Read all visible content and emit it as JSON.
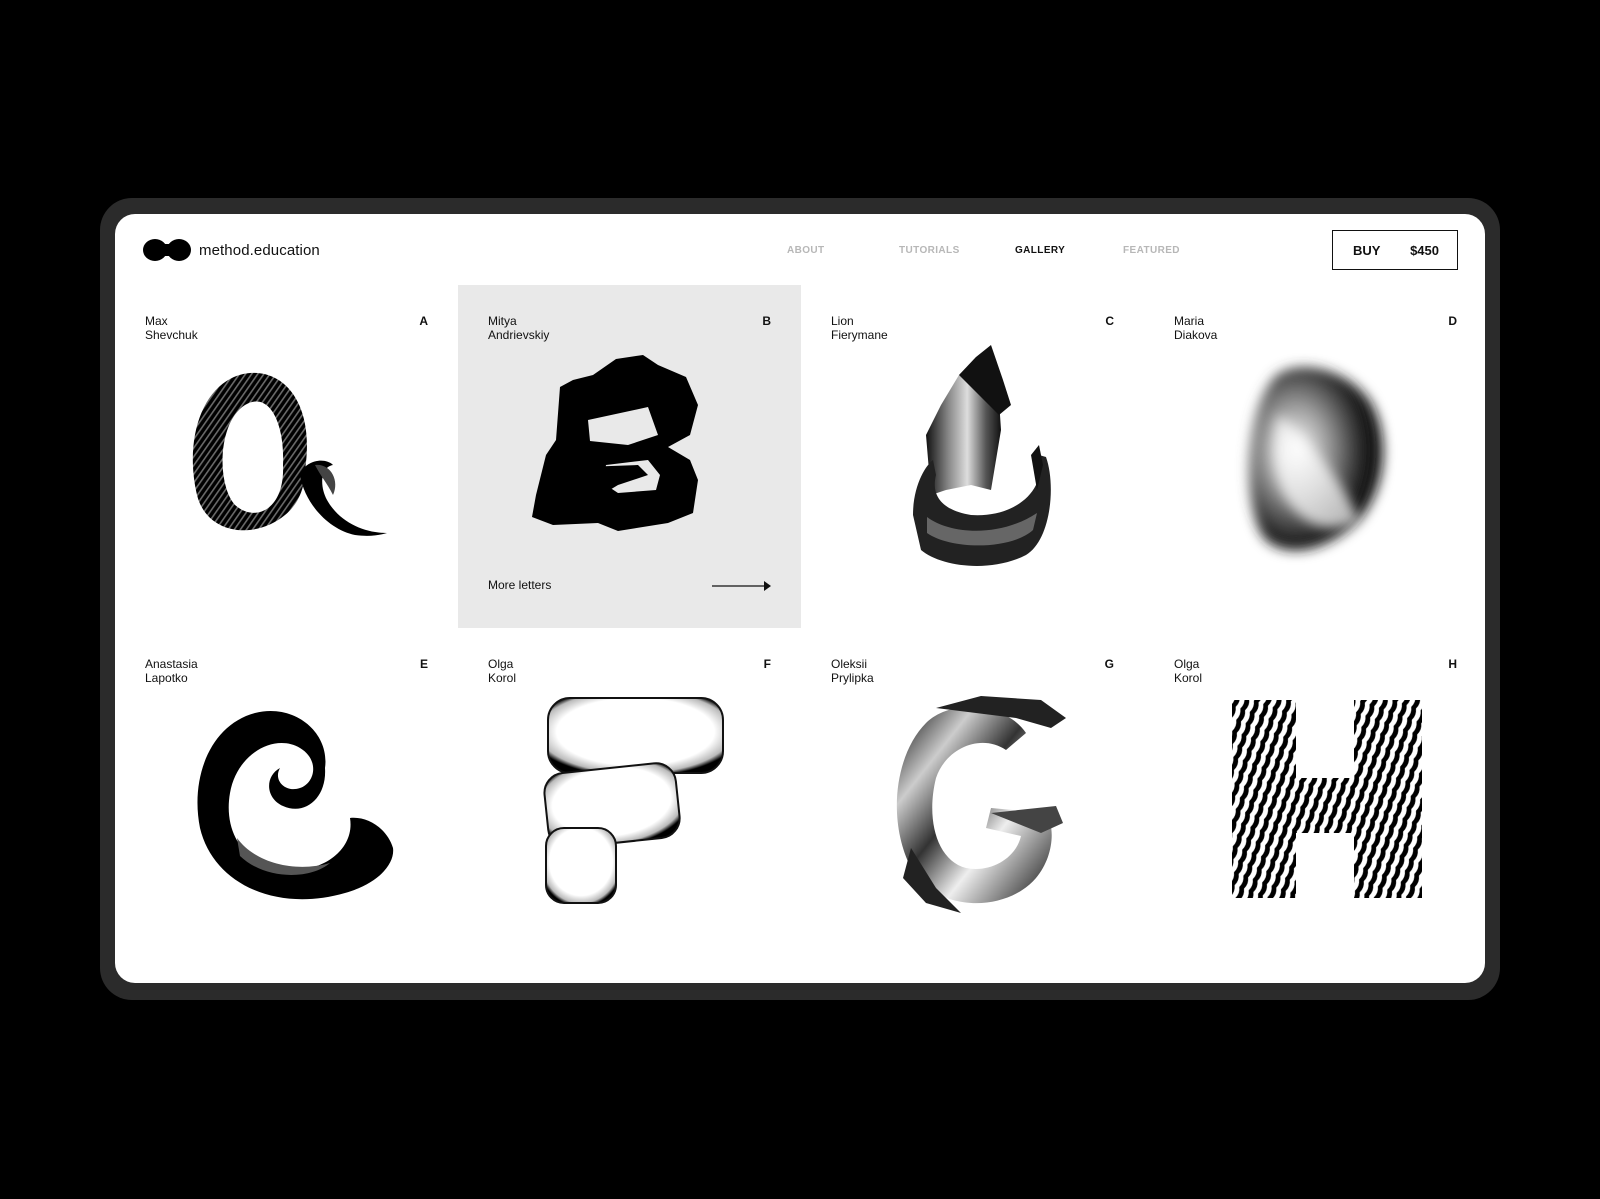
{
  "brand": {
    "name": "method.education"
  },
  "nav": [
    {
      "label": "ABOUT",
      "active": false
    },
    {
      "label": "TUTORIALS",
      "active": false
    },
    {
      "label": "GALLERY",
      "active": true
    },
    {
      "label": "FEATURED",
      "active": false
    }
  ],
  "buy": {
    "label": "BUY",
    "price": "$450"
  },
  "gallery": [
    {
      "first": "Max",
      "last": "Shevchuk",
      "letter": "A",
      "icon": "ribbon-a-icon"
    },
    {
      "first": "Mitya",
      "last": "Andrievskiy",
      "letter": "B",
      "icon": "blackletter-b-icon",
      "more_label": "More letters"
    },
    {
      "first": "Lion",
      "last": "Fierymane",
      "letter": "C",
      "icon": "metal-shard-c-icon"
    },
    {
      "first": "Maria",
      "last": "Diakova",
      "letter": "D",
      "icon": "blurred-d-icon"
    },
    {
      "first": "Anastasia",
      "last": "Lapotko",
      "letter": "E",
      "icon": "spiral-e-icon"
    },
    {
      "first": "Olga",
      "last": "Korol",
      "letter": "F",
      "icon": "soft-stack-f-icon"
    },
    {
      "first": "Oleksii",
      "last": "Prylipka",
      "letter": "G",
      "icon": "chrome-g-icon"
    },
    {
      "first": "Olga",
      "last": "Korol",
      "letter": "H",
      "icon": "zebra-h-icon"
    }
  ],
  "colors": {
    "background": "#000000",
    "frame": "#2b2b2b",
    "highlight": "#e9e9e9",
    "nav_inactive": "#b7b7b7",
    "text": "#111111"
  }
}
